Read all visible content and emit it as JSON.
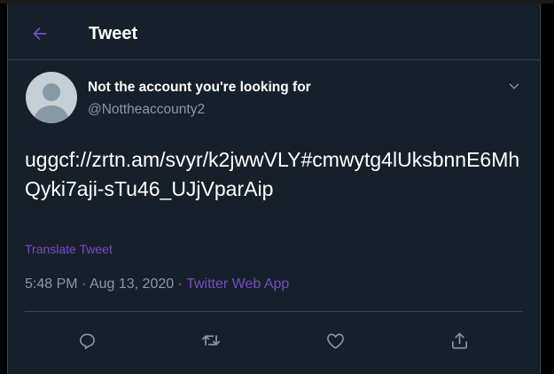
{
  "header": {
    "title": "Tweet",
    "back_icon": "arrow-left-icon"
  },
  "tweet": {
    "display_name": "Not the account you're looking for",
    "handle": "@Nottheaccounty2",
    "text": "uggcf://zrtn.am/svyr/k2jwwVLY#cmwytg4lUksbnnE6MhQyki7aji-sTu46_UJjVparAip",
    "translate_label": "Translate Tweet",
    "time": "5:48 PM",
    "separator": "·",
    "date": "Aug 13, 2020",
    "source": "Twitter Web App"
  },
  "actions": [
    {
      "name": "reply",
      "icon": "reply-icon"
    },
    {
      "name": "retweet",
      "icon": "retweet-icon"
    },
    {
      "name": "like",
      "icon": "heart-icon"
    },
    {
      "name": "share",
      "icon": "share-icon"
    }
  ],
  "colors": {
    "background": "#15202b",
    "accent": "#794bc4",
    "secondary_text": "#8899a6",
    "border": "#38444d"
  }
}
